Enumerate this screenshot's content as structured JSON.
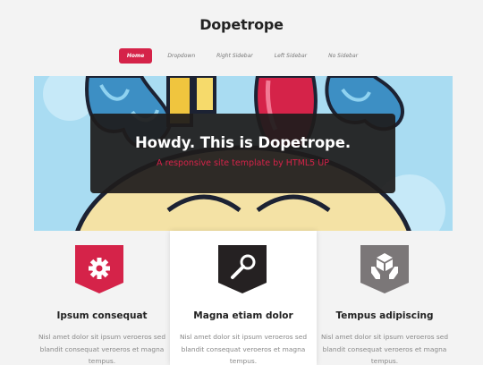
{
  "header": {
    "title": "Dopetrope"
  },
  "nav": {
    "items": [
      {
        "label": "Home"
      },
      {
        "label": "Dropdown"
      },
      {
        "label": "Right Sidebar"
      },
      {
        "label": "Left Sidebar"
      },
      {
        "label": "No Sidebar"
      }
    ]
  },
  "banner": {
    "heading": "Howdy. This is Dopetrope.",
    "subtitle": "A responsive site template by HTML5 UP"
  },
  "features": [
    {
      "title": "Ipsum consequat",
      "icon": "gear-icon",
      "badge_color": "#d52349",
      "lines": [
        "Nisl amet dolor sit ipsum veroeros sed",
        "blandit consequat veroeros et magna",
        "tempus."
      ]
    },
    {
      "title": "Magna etiam dolor",
      "icon": "key-icon",
      "badge_color": "#252122",
      "lines": [
        "Nisl amet dolor sit ipsum veroeros sed",
        "blandit consequat veroeros et magna",
        "tempus."
      ]
    },
    {
      "title": "Tempus adipiscing",
      "icon": "cube-hands-icon",
      "badge_color": "#7b7778",
      "lines": [
        "Nisl amet dolor sit ipsum veroeros sed",
        "blandit consequat veroeros et magna",
        "tempus."
      ]
    }
  ]
}
